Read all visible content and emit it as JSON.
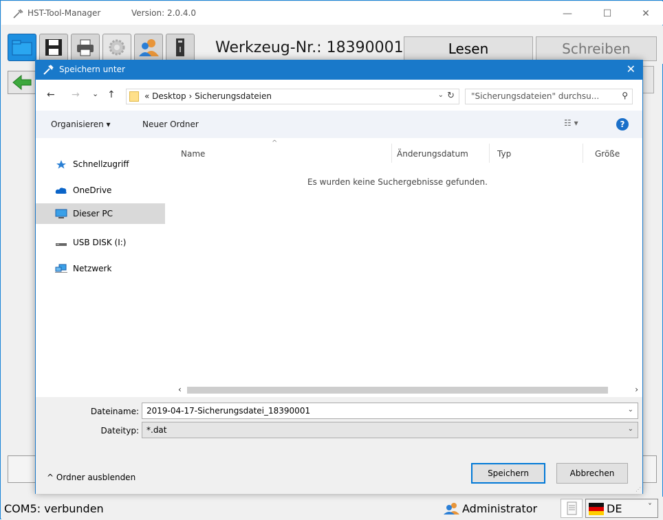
{
  "app": {
    "title": "HST-Tool-Manager",
    "version": "Version: 2.0.4.0",
    "window_controls": [
      "minimize-icon",
      "maximize-icon",
      "close-icon"
    ],
    "toolbar_icons": [
      "open-folder-icon",
      "save-disk-icon",
      "printer-icon",
      "gear-icon",
      "user-icon",
      "usb-device-icon"
    ],
    "werkzeug_label": "Werkzeug-Nr.: 18390001",
    "read_button": "Lesen",
    "write_button": "Schreiben",
    "back_icon": "arrow-left-icon"
  },
  "status": {
    "connection": "COM5: verbunden",
    "user": "Administrator",
    "language": "DE"
  },
  "dialog": {
    "title": "Speichern unter",
    "nav": {
      "back": "←",
      "forward": "→",
      "recent": "⌄",
      "up": "↑"
    },
    "address": "« Desktop › Sicherungsdateien",
    "search_placeholder": "\"Sicherungsdateien\" durchsu...",
    "commands": {
      "organize": "Organisieren ▾",
      "new_folder": "Neuer Ordner"
    },
    "nav_items": [
      {
        "label": "Schnellzugriff",
        "icon": "star-icon"
      },
      {
        "label": "OneDrive",
        "icon": "cloud-icon"
      },
      {
        "label": "Dieser PC",
        "icon": "computer-icon",
        "selected": true
      },
      {
        "label": "USB DISK (I:)",
        "icon": "drive-icon"
      },
      {
        "label": "Netzwerk",
        "icon": "network-icon"
      }
    ],
    "columns": [
      "Name",
      "Änderungsdatum",
      "Typ",
      "Größe"
    ],
    "empty_message": "Es wurden keine Suchergebnisse gefunden.",
    "filename_label": "Dateiname:",
    "filename_value": "2019-04-17-Sicherungsdatei_18390001",
    "filetype_label": "Dateityp:",
    "filetype_value": "*.dat",
    "hide_folders": "Ordner ausblenden",
    "save_button": "Speichern",
    "cancel_button": "Abbrechen"
  },
  "colors": {
    "dialog_titlebar": "#1979ca",
    "selected_nav": "#d9d9d9",
    "primary_border": "#0078d7"
  }
}
